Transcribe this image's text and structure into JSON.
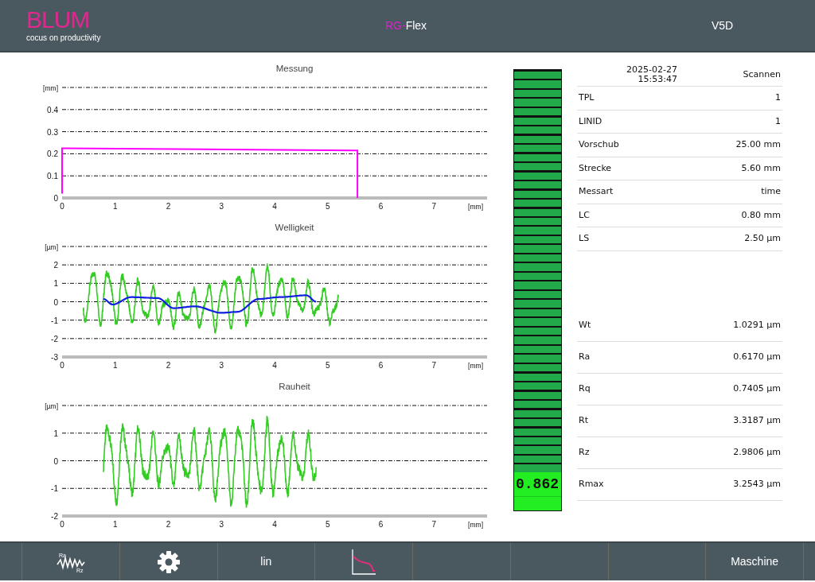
{
  "header": {
    "logo": "BLUM",
    "slogan": "cocus on productivity",
    "app_title": [
      {
        "text": "RG-",
        "color": "#e020d0"
      },
      {
        "text": "Flex",
        "color": "#ffffff"
      }
    ],
    "version": "V5D"
  },
  "charts": [
    {
      "kind": "measurement",
      "chart_data": {
        "type": "line",
        "title": "Messung",
        "x": [
          0,
          0,
          0.02,
          5.55,
          5.56,
          5.56
        ],
        "grid": true,
        "series": [
          {
            "color": "#ff00ff",
            "values": [
              0.02,
              0.225,
              0.225,
              0.215,
              0.215,
              0
            ]
          }
        ],
        "xlim": [
          0,
          8
        ],
        "ylim": [
          0,
          0.5
        ],
        "xticks": [
          0,
          1,
          2,
          3,
          4,
          5,
          6,
          7,
          {
            "value": 8,
            "label": "[mm]"
          }
        ],
        "yticks": [
          0,
          0.1,
          0.2,
          0.3,
          0.4,
          {
            "value": 0.5,
            "label": "[mm]"
          }
        ]
      }
    },
    {
      "kind": "waviness",
      "title": "Welligkeit",
      "y_labels": [
        "[µm]",
        "2",
        "1",
        "0",
        "-1",
        "-2",
        "-3"
      ],
      "x_labels": [
        "0",
        "1",
        "2",
        "3",
        "4",
        "5",
        "6",
        "7",
        "[mm]"
      ]
    },
    {
      "kind": "roughness",
      "title": "Rauheit",
      "y_labels": [
        "[µm]",
        "1",
        "0",
        "-1",
        "-2"
      ],
      "x_labels": [
        "0",
        "1",
        "2",
        "3",
        "4",
        "5",
        "6",
        "7",
        "[mm]"
      ]
    }
  ],
  "meter": {
    "reading": "0.862"
  },
  "info": {
    "date": "2025-02-27",
    "time": "15:53:47",
    "status": "Scannen",
    "parameters": [
      {
        "label": "TPL",
        "value": "1"
      },
      {
        "label": "LINID",
        "value": "1"
      },
      {
        "label": "Vorschub",
        "value": "25.00 mm"
      },
      {
        "label": "Strecke",
        "value": "5.60 mm"
      },
      {
        "label": "Messart",
        "value": "time"
      },
      {
        "label": "LC",
        "value": "0.80 mm"
      },
      {
        "label": "LS",
        "value": "2.50 µm"
      }
    ],
    "results": [
      {
        "label": "Wt",
        "value": "1.0291 µm"
      },
      {
        "label": "Ra",
        "value": "0.6170 µm"
      },
      {
        "label": "Rq",
        "value": "0.7405 µm"
      },
      {
        "label": "Rt",
        "value": "3.3187 µm"
      },
      {
        "label": "Rz",
        "value": "2.9806 µm"
      },
      {
        "label": "Rmax",
        "value": "3.2543 µm"
      }
    ]
  },
  "toolbar": [
    {
      "kind": "roughness",
      "labels": [
        "Ra",
        "Rz"
      ]
    },
    {
      "kind": "gear"
    },
    {
      "kind": "text",
      "label": "lin"
    },
    {
      "kind": "curve"
    },
    {
      "kind": "empty"
    },
    {
      "kind": "empty"
    },
    {
      "kind": "empty"
    },
    {
      "kind": "text",
      "label": "Maschine"
    }
  ]
}
